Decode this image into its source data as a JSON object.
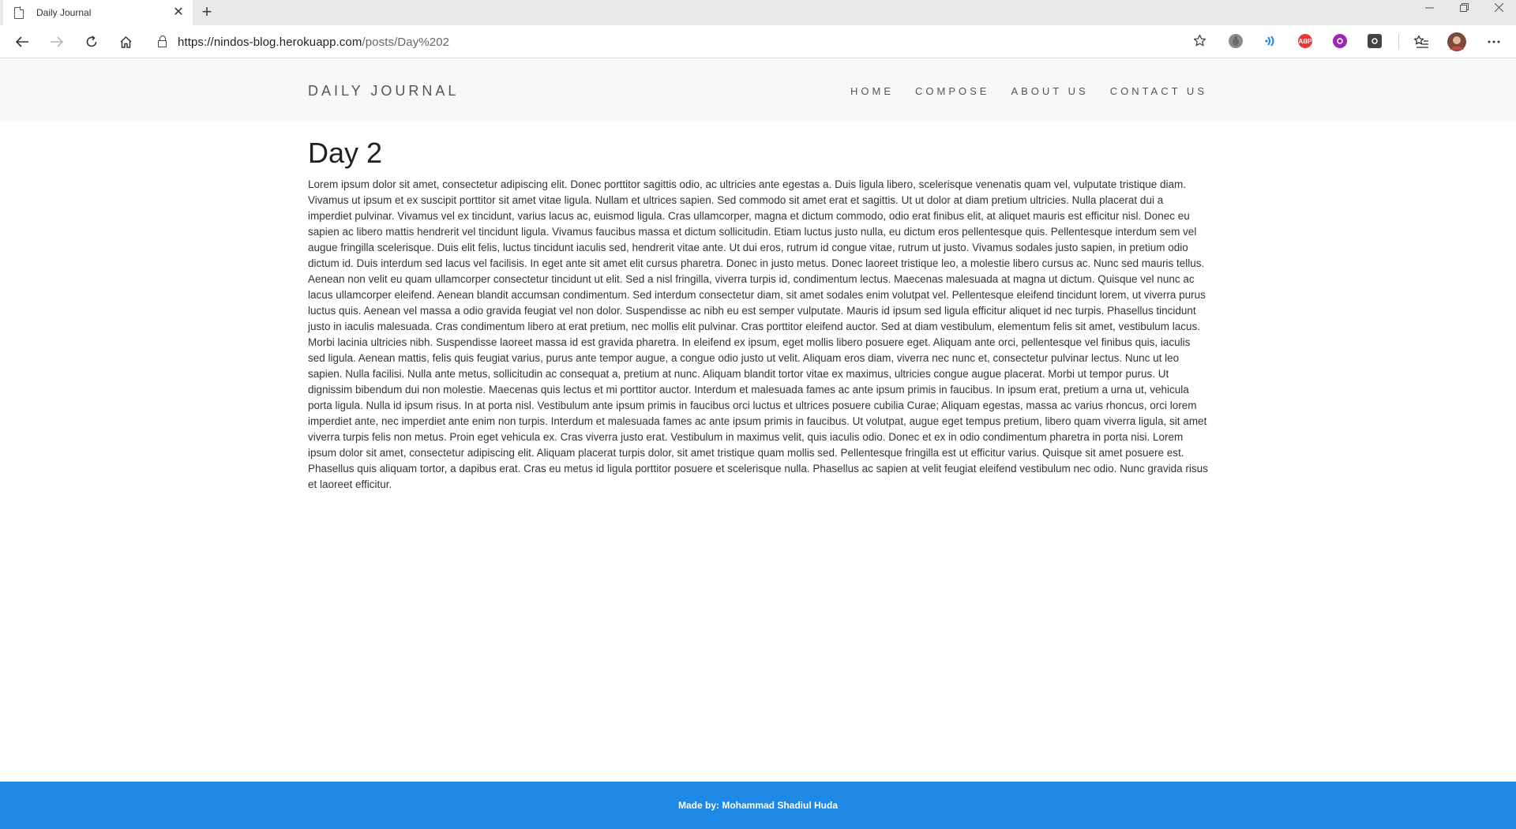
{
  "browser": {
    "tab_title": "Daily Journal",
    "tab_close_glyph": "✕",
    "new_tab_glyph": "+",
    "url_host": "https://nindos-blog.herokuapp.com",
    "url_path": "/posts/Day%202",
    "icons": {
      "back": "arrow-left",
      "forward": "arrow-right",
      "refresh": "refresh",
      "home": "home",
      "favorite": "star",
      "collections": "star-list",
      "menu": "ellipsis"
    },
    "extensions": [
      {
        "name": "bug-extension",
        "label": "",
        "color": "#707070"
      },
      {
        "name": "wave-extension",
        "label": "",
        "color": "#1e88e5"
      },
      {
        "name": "adblock-extension",
        "label": "ABP",
        "color": "#e53935"
      },
      {
        "name": "purple-extension",
        "label": "",
        "color": "#9c27b0"
      },
      {
        "name": "shield-extension",
        "label": "",
        "color": "#444444"
      }
    ]
  },
  "site": {
    "brand": "DAILY JOURNAL",
    "nav": [
      "HOME",
      "COMPOSE",
      "ABOUT US",
      "CONTACT US"
    ],
    "accent": "#1e88e5"
  },
  "post": {
    "title": "Day 2",
    "body": "Lorem ipsum dolor sit amet, consectetur adipiscing elit. Donec porttitor sagittis odio, ac ultricies ante egestas a. Duis ligula libero, scelerisque venenatis quam vel, vulputate tristique diam. Vivamus ut ipsum et ex suscipit porttitor sit amet vitae ligula. Nullam et ultrices sapien. Sed commodo sit amet erat et sagittis. Ut ut dolor at diam pretium ultricies. Nulla placerat dui a imperdiet pulvinar. Vivamus vel ex tincidunt, varius lacus ac, euismod ligula. Cras ullamcorper, magna et dictum commodo, odio erat finibus elit, at aliquet mauris est efficitur nisl. Donec eu sapien ac libero mattis hendrerit vel tincidunt ligula. Vivamus faucibus massa et dictum sollicitudin. Etiam luctus justo nulla, eu dictum eros pellentesque quis. Pellentesque interdum sem vel augue fringilla scelerisque. Duis elit felis, luctus tincidunt iaculis sed, hendrerit vitae ante. Ut dui eros, rutrum id congue vitae, rutrum ut justo. Vivamus sodales justo sapien, in pretium odio dictum id. Duis interdum sed lacus vel facilisis. In eget ante sit amet elit cursus pharetra. Donec in justo metus. Donec laoreet tristique leo, a molestie libero cursus ac. Nunc sed mauris tellus. Aenean non velit eu quam ullamcorper consectetur tincidunt ut elit. Sed a nisl fringilla, viverra turpis id, condimentum lectus. Maecenas malesuada at magna ut dictum. Quisque vel nunc ac lacus ullamcorper eleifend. Aenean blandit accumsan condimentum. Sed interdum consectetur diam, sit amet sodales enim volutpat vel. Pellentesque eleifend tincidunt lorem, ut viverra purus luctus quis. Aenean vel massa a odio gravida feugiat vel non dolor. Suspendisse ac nibh eu est semper vulputate. Mauris id ipsum sed ligula efficitur aliquet id nec turpis. Phasellus tincidunt justo in iaculis malesuada. Cras condimentum libero at erat pretium, nec mollis elit pulvinar. Cras porttitor eleifend auctor. Sed at diam vestibulum, elementum felis sit amet, vestibulum lacus. Morbi lacinia ultricies nibh. Suspendisse laoreet massa id est gravida pharetra. In eleifend ex ipsum, eget mollis libero posuere eget. Aliquam ante orci, pellentesque vel finibus quis, iaculis sed ligula. Aenean mattis, felis quis feugiat varius, purus ante tempor augue, a congue odio justo ut velit. Aliquam eros diam, viverra nec nunc et, consectetur pulvinar lectus. Nunc ut leo sapien. Nulla facilisi. Nulla ante metus, sollicitudin ac consequat a, pretium at nunc. Aliquam blandit tortor vitae ex maximus, ultricies congue augue placerat. Morbi ut tempor purus. Ut dignissim bibendum dui non molestie. Maecenas quis lectus et mi porttitor auctor. Interdum et malesuada fames ac ante ipsum primis in faucibus. In ipsum erat, pretium a urna ut, vehicula porta ligula. Nulla id ipsum risus. In at porta nisl. Vestibulum ante ipsum primis in faucibus orci luctus et ultrices posuere cubilia Curae; Aliquam egestas, massa ac varius rhoncus, orci lorem imperdiet ante, nec imperdiet ante enim non turpis. Interdum et malesuada fames ac ante ipsum primis in faucibus. Ut volutpat, augue eget tempus pretium, libero quam viverra ligula, sit amet viverra turpis felis non metus. Proin eget vehicula ex. Cras viverra justo erat. Vestibulum in maximus velit, quis iaculis odio. Donec et ex in odio condimentum pharetra in porta nisi. Lorem ipsum dolor sit amet, consectetur adipiscing elit. Aliquam placerat turpis dolor, sit amet tristique quam mollis sed. Pellentesque fringilla est ut efficitur varius. Quisque sit amet posuere est. Phasellus quis aliquam tortor, a dapibus erat. Cras eu metus id ligula porttitor posuere et scelerisque nulla. Phasellus ac sapien at velit feugiat eleifend vestibulum nec odio. Nunc gravida risus et laoreet efficitur."
  },
  "footer": {
    "text": "Made by: Mohammad Shadiul Huda"
  }
}
